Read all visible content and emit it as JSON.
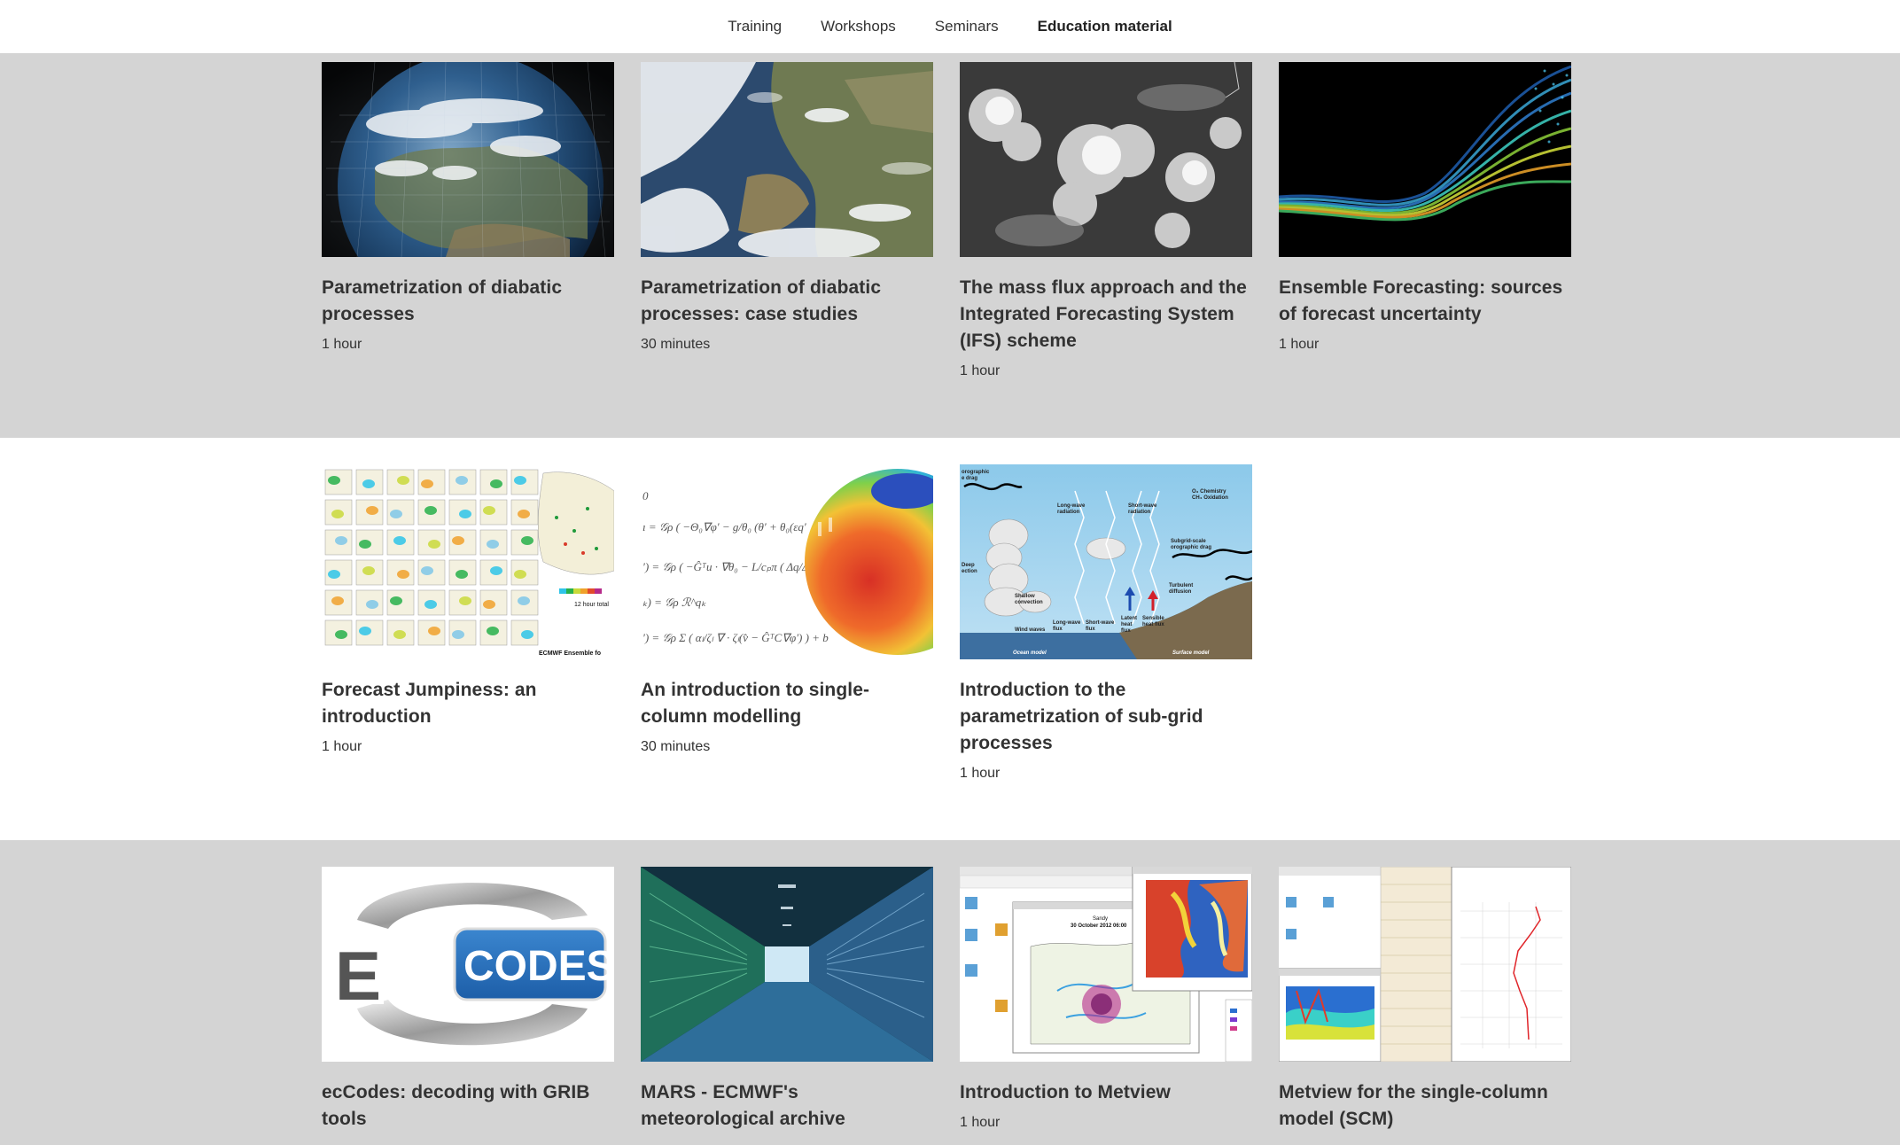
{
  "nav": {
    "items": [
      {
        "label": "Training",
        "active": false
      },
      {
        "label": "Workshops",
        "active": false
      },
      {
        "label": "Seminars",
        "active": false
      },
      {
        "label": "Education material",
        "active": true
      }
    ]
  },
  "rows": [
    {
      "band": "gray",
      "cards": [
        {
          "title": "Parametrization of diabatic processes",
          "duration": "1 hour",
          "thumb": "earth-globe-grid-image"
        },
        {
          "title": "Parametrization of diabatic processes: case studies",
          "duration": "30 minutes",
          "thumb": "satellite-europe-clouds-image"
        },
        {
          "title": "The mass flux approach and the Integrated Forecasting System (IFS) scheme",
          "duration": "1 hour",
          "thumb": "satellite-cloud-cluster-image"
        },
        {
          "title": "Ensemble Forecasting: sources of forecast uncertainty",
          "duration": "1 hour",
          "thumb": "ensemble-trajectories-image"
        }
      ]
    },
    {
      "band": "white",
      "cards": [
        {
          "title": "Forecast Jumpiness: an introduction",
          "duration": "1 hour",
          "thumb": "ensemble-map-panels-image",
          "thumb_text": {
            "legend": "12 hour total",
            "footer": "ECMWF Ensemble fo"
          }
        },
        {
          "title": "An introduction to single-column modelling",
          "duration": "30 minutes",
          "thumb": "equations-sphere-image"
        },
        {
          "title": "Introduction to the parametrization of sub-grid processes",
          "duration": "1 hour",
          "thumb": "physics-schematic-image",
          "thumb_text": {
            "top_left": "orographic\ne drag",
            "long_wave": "Long-wave\nradiation",
            "short_wave": "Short-wave\nradiation",
            "chemistry": "O₃ Chemistry\nCH₄ Oxidation",
            "subgrid": "Subgrid-scale\norographic drag",
            "deep": "Deep\nection",
            "shallow": "Shallow\nconvection",
            "wind": "Wind waves",
            "lw_flux": "Long-wave\nflux",
            "sw_flux": "Short-wave\nflux",
            "latent": "Latent\nheat\nflux",
            "sensible": "Sensible\nheat flux",
            "turbulent": "Turbulent\ndiffusion",
            "ocean": "Ocean model",
            "surface": "Surface model"
          }
        }
      ]
    },
    {
      "band": "gray",
      "cards": [
        {
          "title": "ecCodes: decoding with GRIB tools",
          "duration": "",
          "thumb": "eccodes-logo-image",
          "thumb_text": {
            "logo": "CODES",
            "letter": "E"
          }
        },
        {
          "title": "MARS - ECMWF's meteorological archive",
          "duration": "",
          "thumb": "data-center-corridor-image"
        },
        {
          "title": "Introduction to Metview",
          "duration": "1 hour",
          "thumb": "metview-screenshot-image",
          "thumb_text": {
            "storm": "Sandy",
            "date": "30 October 2012 06:00"
          }
        },
        {
          "title": "Metview for the single-column model (SCM)",
          "duration": "",
          "thumb": "metview-scm-screenshot-image"
        }
      ]
    }
  ],
  "colors": {
    "band_gray": "#d4d4d4",
    "band_white": "#ffffff",
    "text": "#333333"
  }
}
